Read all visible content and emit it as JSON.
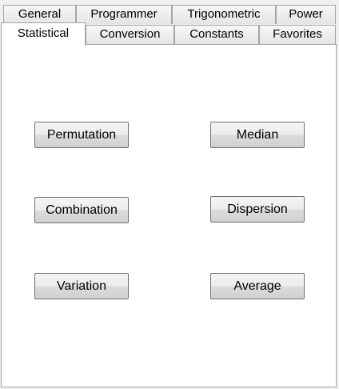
{
  "tabs": {
    "row_back": [
      "General",
      "Programmer",
      "Trigonometric",
      "Power"
    ],
    "row_front": [
      "Statistical",
      "Conversion",
      "Constants",
      "Favorites"
    ],
    "active": "Statistical"
  },
  "buttons": {
    "permutation": "Permutation",
    "median": "Median",
    "combination": "Combination",
    "dispersion": "Dispersion",
    "variation": "Variation",
    "average": "Average"
  }
}
